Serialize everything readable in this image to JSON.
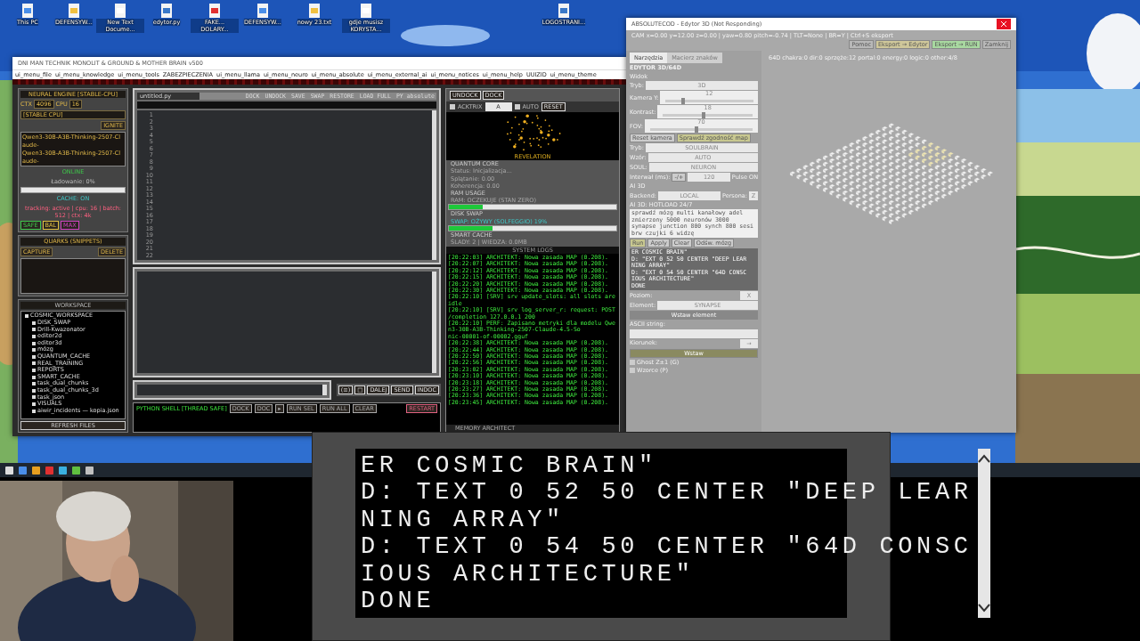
{
  "desktop": {
    "icons": [
      {
        "label": "This PC"
      },
      {
        "label": "DEFENSYW..."
      },
      {
        "label": "New Text Docume..."
      },
      {
        "label": "edytor.py"
      },
      {
        "label": "FAKE... DOLARY..."
      },
      {
        "label": "DEFENSYW..."
      },
      {
        "label": "nowy 23.txt"
      },
      {
        "label": "gdje musisz KORYSTA..."
      },
      {
        "label": "LOGOSTRANI..."
      }
    ]
  },
  "main_window": {
    "title": "DNI MAN TECHNIK MONOLIT & GROUND & MOTHER BRAIN v500",
    "menu": [
      "ui_menu_file",
      "ui_menu_knowledge",
      "ui_menu_tools",
      "ZABEZPIECZENIA",
      "ui_menu_llama",
      "ui_menu_neuro",
      "ui_menu_absolute",
      "ui_menu_external_ai",
      "ui_menu_notices",
      "ui_menu_help",
      "UUIZID",
      "ui_menu_theme"
    ],
    "engine": {
      "title": "NEURAL ENGINE [STABLE-CPU]",
      "ctx_label": "CTX",
      "ctx": "4096",
      "cpu_label": "CPU",
      "cpu": "16",
      "mode": "[STABLE CPU]",
      "ignite": "IGNITE",
      "models": [
        "Qwen3-30B-A3B-Thinking-2507-Claude-",
        "Qwen3-30B-A3B-Thinking-2507-Claude-"
      ],
      "status": "ONLINE",
      "loading": "Ładowanie: 0%",
      "cache": "CACHE: ON",
      "stats": "tracking: active | cpu: 16 | batch: 512 | ctx: 4k",
      "profiles": [
        {
          "label": "SAFE",
          "color": "#3ec84a"
        },
        {
          "label": "BAL",
          "color": "#e0c040"
        },
        {
          "label": "MAX",
          "color": "#d040c0"
        }
      ]
    },
    "quarks": {
      "title": "QUARKS (SNIPPETS)",
      "capture": "CAPTURE",
      "delete": "DELETE"
    },
    "workspace": {
      "title": "WORKSPACE",
      "tree": [
        {
          "label": "COSMIC_WORKSPACE",
          "children": [
            {
              "label": "DISK_SWAP"
            },
            {
              "label": "Drill-Kwazonator"
            },
            {
              "label": "editor2d"
            },
            {
              "label": "editor3d"
            },
            {
              "label": "mózg"
            },
            {
              "label": "QUANTUM_CACHE"
            },
            {
              "label": "REAL_TRAINING"
            },
            {
              "label": "REPORTS"
            },
            {
              "label": "SMART_CACHE"
            },
            {
              "label": "task_dual_chunks"
            },
            {
              "label": "task_dual_chunks_3d"
            },
            {
              "label": "task_json"
            },
            {
              "label": "VISUALS"
            },
            {
              "label": "aiwir_incidents — kopia.json"
            }
          ]
        }
      ],
      "refresh": "REFRESH FILES"
    },
    "editor": {
      "tab": "untitled.py",
      "actions": [
        "DOCK",
        "UNDOCK",
        "SAVE",
        "SWAP",
        "RESTORE",
        "LOAD FULL",
        "PY absolute"
      ],
      "line_numbers": [
        "1",
        "2",
        "3",
        "4",
        "5",
        "6",
        "7",
        "8",
        "9",
        "10",
        "11",
        "12",
        "13",
        "14",
        "15",
        "16",
        "17",
        "18",
        "19",
        "20",
        "21",
        "22"
      ],
      "chat_buttons": [
        "(≡)",
        "□",
        "DALEJ",
        "SEND",
        "INDOC"
      ],
      "shell": {
        "title": "PYTHON SHELL [THREAD SAFE]",
        "buttons": [
          "DOCK",
          "DOC",
          "▸",
          "RUN SEL",
          "RUN ALL",
          "CLEAR"
        ],
        "restart": "RESTART"
      }
    },
    "monitor": {
      "undock": "UNDOCK",
      "dock": "DOCK",
      "toggles": [
        {
          "label": "ACKTRIX",
          "checked": true
        },
        {
          "label": "AUTO",
          "checked": true
        }
      ],
      "select": "A",
      "reset": "RESET",
      "caption": "REVELATION",
      "quantum": {
        "title": "QUANTUM CORE",
        "lines": [
          "Status: Inicjalizacja...",
          "Splątanie: 0.00",
          "Koherencja: 0.00"
        ]
      },
      "ram": {
        "title": "RAM USAGE",
        "text": "RAM: OCZEKUJE (STAN ZERO)",
        "level": 0.2
      },
      "swap": {
        "title": "DISK SWAP",
        "text": "SWAP: OŻYWY (SOLFEGGIO) 19%",
        "level": 0.26
      },
      "cache": {
        "title": "SMART CACHE",
        "text": "ŚLADY: 2 | WIEDZA: 0.0MB"
      },
      "logs_title": "SYSTEM LOGS",
      "logs": [
        "[20:22:03] ARCHITEKT: Nowa zasada MAP (0.208).",
        "[20:22:07] ARCHITEKT: Nowa zasada MAP (0.208).",
        "[20:22:12] ARCHITEKT: Nowa zasada MAP (0.208).",
        "[20:22:15] ARCHITEKT: Nowa zasada MAP (0.208).",
        "[20:22:20] ARCHITEKT: Nowa zasada MAP (0.208).",
        "[20:22:30] ARCHITEKT: Nowa zasada MAP (0.208).",
        "[20:22:10] [SRV] srv  update_slots: all slots are idle",
        "[20:22:10] [SRV] srv  log_server_r: request: POST /completion 127.0.0.1 200",
        "[20:22:10] PERF: Zapisano metryki dla modelu Qwen3-30B-A3B-Thinking-2507-Claude-4.5-So",
        "nic-00001-of-00002.gguf",
        "[20:22:38] ARCHITEKT: Nowa zasada MAP (0.208).",
        "[20:22:44] ARCHITEKT: Nowa zasada MAP (0.208).",
        "[20:22:50] ARCHITEKT: Nowa zasada MAP (0.208).",
        "[20:22:56] ARCHITEKT: Nowa zasada MAP (0.208).",
        "[20:23:02] ARCHITEKT: Nowa zasada MAP (0.208).",
        "[20:23:10] ARCHITEKT: Nowa zasada MAP (0.208).",
        "[20:23:18] ARCHITEKT: Nowa zasada MAP (0.208).",
        "[20:23:27] ARCHITEKT: Nowa zasada MAP (0.208).",
        "[20:23:36] ARCHITEKT: Nowa zasada MAP (0.208).",
        "[20:23:45] ARCHITEKT: Nowa zasada MAP (0.208)."
      ],
      "footer": "MEMORY ARCHITECT"
    }
  },
  "editor3d": {
    "title": "ABSOLUTECOD - Edytor 3D (Not Responding)",
    "status": "CAM x=0.00 y=12.00 z=0.00 | yaw=0.80 pitch=-0.74 | TLT=None | BR=Y | Ctrl+S eksport",
    "buttons": [
      {
        "label": "Pomoc",
        "color": "#b8b8b8"
      },
      {
        "label": "Eksport → Edytor",
        "color": "#cfc79a"
      },
      {
        "label": "Eksport → RUN",
        "color": "#a8d8a0"
      },
      {
        "label": "Zamknij",
        "color": "#b8b8b8"
      }
    ],
    "tabs": [
      {
        "label": "Narzędzia",
        "selected": true
      },
      {
        "label": "Macierz znaków",
        "selected": false
      }
    ],
    "heading": "EDYTOR 3D/64D",
    "group": "Widok",
    "rows": [
      {
        "kind": "select",
        "label": "Tryb:",
        "value": "3D"
      },
      {
        "kind": "slider",
        "label": "Kamera Y:",
        "value": "12",
        "level": 0.2
      },
      {
        "kind": "slider",
        "label": "Kontrast:",
        "value": "18",
        "level": 0.45
      },
      {
        "kind": "slider",
        "label": "FOV:",
        "value": "70",
        "level": 0.45
      }
    ],
    "reset": "Reset kamera",
    "check": "Sprawdź zgodność map",
    "selects": [
      {
        "label": "Tryb:",
        "value": "SOULBRAIN"
      },
      {
        "label": "Wzór:",
        "value": "AUTO"
      },
      {
        "label": "SOUL:",
        "value": "NEURON"
      }
    ],
    "interval_label": "Interwał (ms):",
    "interval_btn": "-/+",
    "interval": "120",
    "pulse": "Pulse ON",
    "ai_group": "AI 3D",
    "backend_label": "Backend:",
    "backend": "LOCAL",
    "persona_label": "Persona:",
    "persona": "Z",
    "ai_hint": "AI 3D: HOTLOAD 24/7",
    "prompt": "sprawdź mózg multi kanałowy adel zmierzony 5000 neuronów 3000 synapse junction 800 synch 800 sesi brw czujki 6 widzę",
    "ai_buttons": [
      "Run",
      "Apply",
      "Clear",
      "Odśw. mózg"
    ],
    "code": [
      "ER COSMIC BRAIN\"",
      "D: \"EXT 0 52 50 CENTER \"DEEP LEAR",
      "NING ARRAY\"",
      "D: \"EXT 0 54 50 CENTER \"64D CONSC",
      "IOUS ARCHITECTURE\"",
      "DONE"
    ],
    "level_label": "Poziom:",
    "level_value": "X",
    "element_label": "Element:",
    "element": "SYNAPSE",
    "insert_element": "Wstaw element",
    "ascii_label": "ASCII string:",
    "glyph_label": "Kierunek:",
    "glyph": "→",
    "insert": "Wstaw",
    "checks": [
      {
        "label": "Ghost Z±1 (G)",
        "checked": true
      },
      {
        "label": "Wzorce (P)",
        "checked": true
      }
    ],
    "canvas_info": "64D chakra:0 dir:0 sprzęże:12 portal:0 energy:0 logic:0 other:4/8"
  },
  "terminal": {
    "lines": [
      "ER COSMIC BRAIN\"",
      "D: TEXT 0 52 50 CENTER \"DEEP LEAR",
      "NING ARRAY\"",
      "D: TEXT 0 54 50 CENTER \"64D CONSC",
      "IOUS ARCHITECTURE\"",
      "DONE"
    ]
  }
}
